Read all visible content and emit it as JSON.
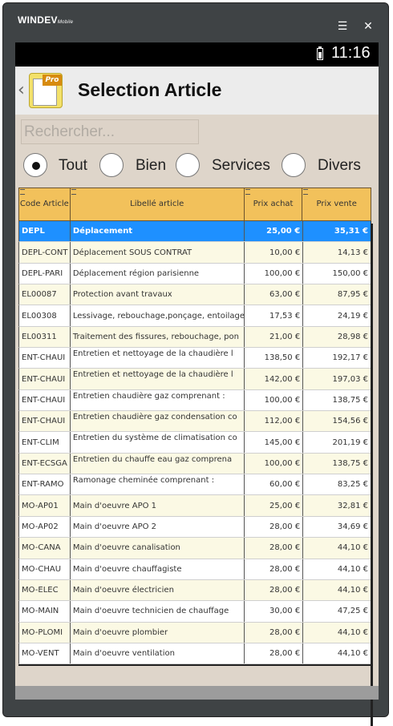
{
  "frame": {
    "brand": "WINDEV",
    "brand_suffix": "Mobile",
    "menu_icon": "menu-icon",
    "close_icon": "close-icon"
  },
  "status": {
    "time": "11:16",
    "battery_icon": "battery-icon"
  },
  "header": {
    "back_icon": "chevron-left-icon",
    "title": "Selection Article"
  },
  "search": {
    "placeholder": "Rechercher..."
  },
  "filters": {
    "selected": "Tout",
    "options": [
      "Tout",
      "Bien",
      "Services",
      "Divers"
    ]
  },
  "table": {
    "columns": [
      "Code Article",
      "Libellé article",
      "Prix achat",
      "Prix vente"
    ],
    "rows": [
      {
        "code": "DEPL",
        "label": "Déplacement",
        "achat": "25,00 €",
        "vente": "35,31 €"
      },
      {
        "code": "DEPL-CONT",
        "label": "Déplacement SOUS CONTRAT",
        "achat": "10,00 €",
        "vente": "14,13 €"
      },
      {
        "code": "DEPL-PARI",
        "label": "Déplacement région parisienne",
        "achat": "100,00 €",
        "vente": "150,00 €"
      },
      {
        "code": "EL00087",
        "label": "Protection avant travaux",
        "achat": "63,00 €",
        "vente": "87,95 €"
      },
      {
        "code": "EL00308",
        "label": "Lessivage, rebouchage,ponçage, entoilage",
        "achat": "17,53 €",
        "vente": "24,19 €"
      },
      {
        "code": "EL00311",
        "label": "Traitement des fissures, rebouchage, pon",
        "achat": "21,00 €",
        "vente": "28,98 €"
      },
      {
        "code": "ENT-CHAUI",
        "label": "Entretien et nettoyage de la chaudière l",
        "achat": "138,50 €",
        "vente": "192,17 €"
      },
      {
        "code": "ENT-CHAUI",
        "label": "Entretien et nettoyage de la chaudière l",
        "achat": "142,00 €",
        "vente": "197,03 €"
      },
      {
        "code": "ENT-CHAUI",
        "label": "Entretien chaudière gaz comprenant :",
        "achat": "100,00 €",
        "vente": "138,75 €"
      },
      {
        "code": "ENT-CHAUI",
        "label": "Entretien chaudière gaz condensation co",
        "achat": "112,00 €",
        "vente": "154,56 €"
      },
      {
        "code": "ENT-CLIM",
        "label": "Entretien du système de climatisation co",
        "achat": "145,00 €",
        "vente": "201,19 €"
      },
      {
        "code": "ENT-ECSGA",
        "label": "Entretien du chauffe eau  gaz comprena",
        "achat": "100,00 €",
        "vente": "138,75 €"
      },
      {
        "code": "ENT-RAMO",
        "label": "Ramonage cheminée comprenant :",
        "achat": "60,00 €",
        "vente": "83,25 €"
      },
      {
        "code": "MO-AP01",
        "label": "Main d'oeuvre APO 1",
        "achat": "25,00 €",
        "vente": "32,81 €"
      },
      {
        "code": "MO-AP02",
        "label": "Main d'oeuvre APO 2",
        "achat": "28,00 €",
        "vente": "34,69 €"
      },
      {
        "code": "MO-CANA",
        "label": "Main d'oeuvre canalisation",
        "achat": "28,00 €",
        "vente": "44,10 €"
      },
      {
        "code": "MO-CHAU",
        "label": "Main d'oeuvre chauffagiste",
        "achat": "28,00 €",
        "vente": "44,10 €"
      },
      {
        "code": "MO-ELEC",
        "label": "Main d'oeuvre électricien",
        "achat": "28,00 €",
        "vente": "44,10 €"
      },
      {
        "code": "MO-MAIN",
        "label": "Main d'oeuvre technicien de chauffage",
        "achat": "30,00 €",
        "vente": "47,25 €"
      },
      {
        "code": "MO-PLOMI",
        "label": "Main d'oeuvre plombier",
        "achat": "28,00 €",
        "vente": "44,10 €"
      },
      {
        "code": "MO-VENT",
        "label": "Main d'oeuvre ventilation",
        "achat": "28,00 €",
        "vente": "44,10 €"
      }
    ]
  }
}
